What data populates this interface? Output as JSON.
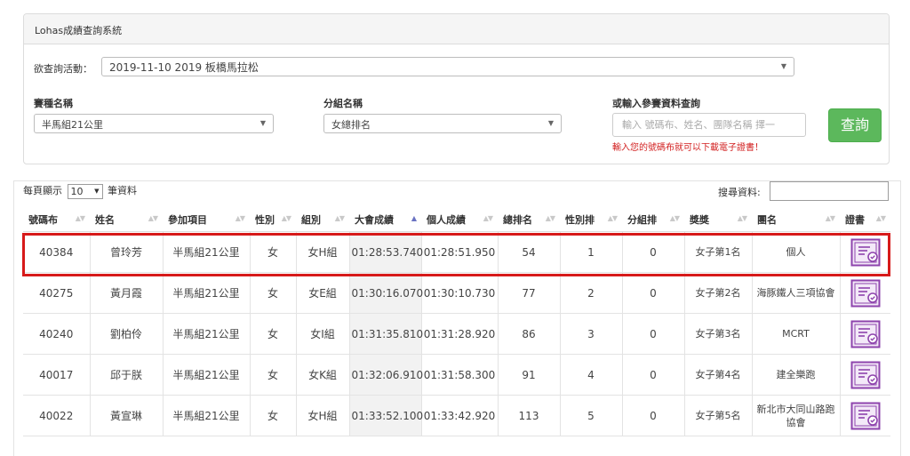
{
  "panel": {
    "title": "Lohas成績查詢系統",
    "activity_label": "欲查詢活動：",
    "activity_value": "2019-11-10 2019 板橋馬拉松",
    "race_label": "賽種名稱",
    "race_value": "半馬組21公里",
    "group_label": "分組名稱",
    "group_value": "女總排名",
    "search_label": "或輸入參賽資料查詢",
    "search_placeholder": "輸入 號碼布、姓名、團隊名稱 擇一",
    "hint": "輸入您的號碼布就可以下載電子證書！",
    "query_button": "查詢"
  },
  "results": {
    "length_prefix": "每頁顯示",
    "length_value": "10",
    "length_suffix": "筆資料",
    "filter_label": "搜尋資料:",
    "columns": [
      "號碼布",
      "姓名",
      "參加項目",
      "性別",
      "組別",
      "大會成績",
      "個人成績",
      "總排名",
      "性別排",
      "分組排",
      "獎獎",
      "團名",
      "證書"
    ],
    "sorted_column": "大會成績",
    "rows": [
      {
        "bib": "40384",
        "name": "曾玲芳",
        "event": "半馬組21公里",
        "gender": "女",
        "group": "女H組",
        "gun_time": "01:28:53.740",
        "chip_time": "01:28:51.950",
        "overall": "54",
        "gender_rank": "1",
        "group_rank": "0",
        "award": "女子第1名",
        "team": "個人"
      },
      {
        "bib": "40275",
        "name": "黃月霞",
        "event": "半馬組21公里",
        "gender": "女",
        "group": "女E組",
        "gun_time": "01:30:16.070",
        "chip_time": "01:30:10.730",
        "overall": "77",
        "gender_rank": "2",
        "group_rank": "0",
        "award": "女子第2名",
        "team": "海豚鐵人三項協會"
      },
      {
        "bib": "40240",
        "name": "劉柏伶",
        "event": "半馬組21公里",
        "gender": "女",
        "group": "女I組",
        "gun_time": "01:31:35.810",
        "chip_time": "01:31:28.920",
        "overall": "86",
        "gender_rank": "3",
        "group_rank": "0",
        "award": "女子第3名",
        "team": "MCRT"
      },
      {
        "bib": "40017",
        "name": "邱于朕",
        "event": "半馬組21公里",
        "gender": "女",
        "group": "女K組",
        "gun_time": "01:32:06.910",
        "chip_time": "01:31:58.300",
        "overall": "91",
        "gender_rank": "4",
        "group_rank": "0",
        "award": "女子第4名",
        "team": "建全樂跑"
      },
      {
        "bib": "40022",
        "name": "黃宣琳",
        "event": "半馬組21公里",
        "gender": "女",
        "group": "女H組",
        "gun_time": "01:33:52.100",
        "chip_time": "01:33:42.920",
        "overall": "113",
        "gender_rank": "5",
        "group_rank": "0",
        "award": "女子第5名",
        "team": "新北市大同山路跑協會"
      }
    ]
  },
  "colors": {
    "query_button": "#5cb85c",
    "hint_text": "#d21f1f",
    "highlight_border": "#d71a1a",
    "certificate_icon": "#8e44ad"
  }
}
